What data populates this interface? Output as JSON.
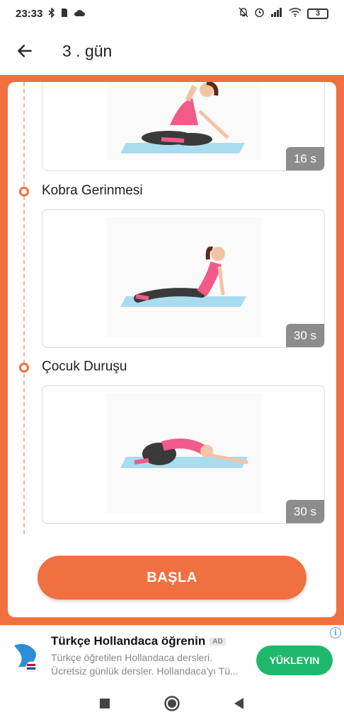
{
  "status_bar": {
    "time": "23:33",
    "battery": "3"
  },
  "app_bar": {
    "title": "3 . gün"
  },
  "exercises": [
    {
      "name": "",
      "duration": "16 s"
    },
    {
      "name": "Kobra Gerinmesi",
      "duration": "30 s"
    },
    {
      "name": "Çocuk Duruşu",
      "duration": "30 s"
    }
  ],
  "start_button": {
    "label": "BAŞLA"
  },
  "ad": {
    "title": "Türkçe Hollandaca öğrenin",
    "badge": "AD",
    "line1": "Türkçe öğretilen Hollandaca dersleri.",
    "line2": "Ücretsiz günlük dersler. Hollandaca'yı Tü...",
    "button": "YÜKLEYIN"
  },
  "colors": {
    "accent": "#f07040",
    "install_green": "#1fb86a",
    "duration_badge": "#8c8c8c"
  }
}
